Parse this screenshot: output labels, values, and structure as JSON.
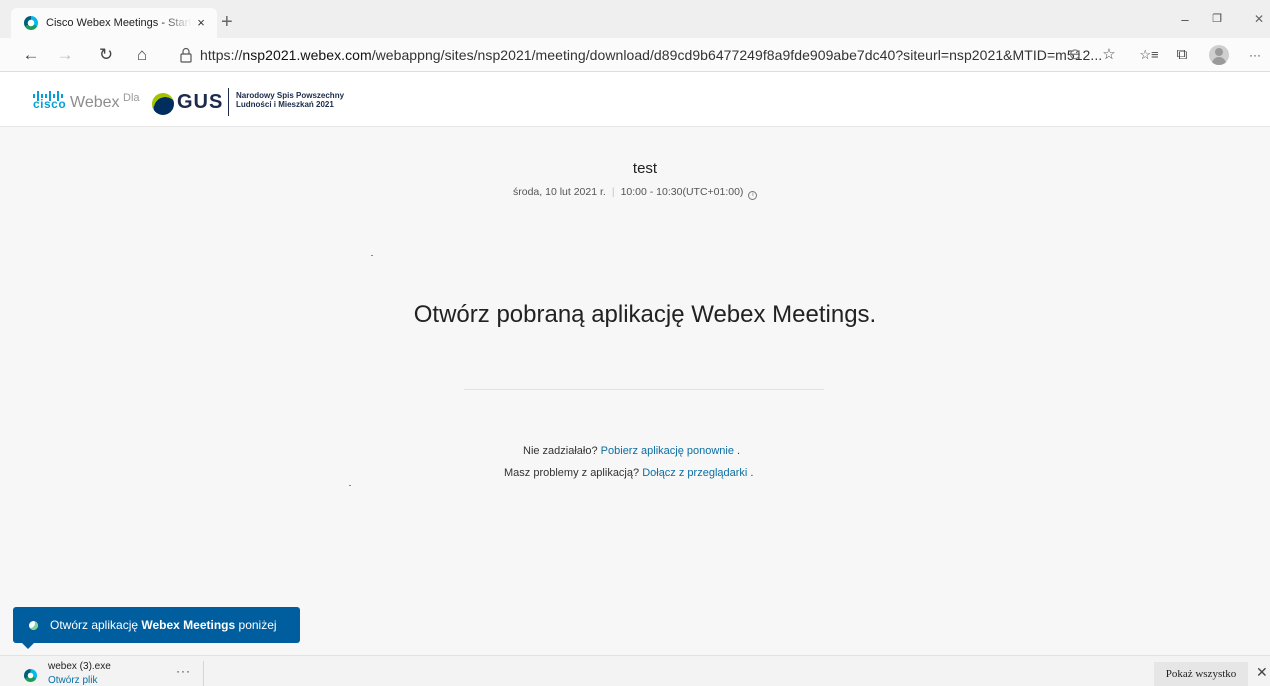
{
  "browser": {
    "tab_title": "Cisco Webex Meetings - Start Yo",
    "tab_close": "×",
    "new_tab": "+",
    "url_scheme": "https://",
    "url_host": "nsp2021.webex.com",
    "url_rest": "/webappng/sites/nsp2021/meeting/download/d89cd9b6477249f8a9fde909abe7dc40?siteurl=nsp2021&MTID=m512...",
    "icons": [
      "back-icon",
      "forward-icon",
      "refresh-icon",
      "home-icon",
      "lock-icon",
      "zoom-icon",
      "add-favorite-icon",
      "favorites-icon",
      "collections-icon",
      "profile-icon",
      "more-icon"
    ],
    "glyphs": {
      "back": "←",
      "forward": "→",
      "refresh": "↻",
      "home": "⌂",
      "zoom": "⊖",
      "add_favorite": "☆",
      "favorites": "☆≡",
      "collections": "⧉",
      "more": "···",
      "minimize": "–",
      "maximize": "❐",
      "close": "✕"
    }
  },
  "header": {
    "cisco": "cisco",
    "webex": "Webex",
    "dla": "Dla",
    "gus": "GUS",
    "gus_sub_line1": "Narodowy Spis Powszechny",
    "gus_sub_line2": "Ludności i Mieszkań 2021"
  },
  "meeting": {
    "title": "test",
    "date": "środa, 10 lut 2021 r.",
    "date_sep": "|",
    "time": "10:00 - 10:30(UTC+01:00)",
    "info_glyph": "i"
  },
  "main": {
    "headline": "Otwórz pobraną aplikację Webex Meetings.",
    "line1_text": "Nie zadziałało?",
    "line1_link": "Pobierz aplikację ponownie",
    "line1_end": ".",
    "line2_text": "Masz problemy z aplikacją?",
    "line2_link": "Dołącz z przeglądarki",
    "line2_end": "."
  },
  "toast": {
    "prefix": "Otwórz aplikację",
    "bold": "Webex Meetings",
    "suffix": "poniżej"
  },
  "download_bar": {
    "file_name": "webex (3).exe",
    "open_file": "Otwórz plik",
    "more": "···",
    "show_all": "Pokaż wszystko",
    "close": "✕"
  },
  "colors": {
    "accent": "#005e9e",
    "link": "#0b6fa4",
    "cisco_blue": "#049fd9",
    "gus_navy": "#1a2b4c"
  }
}
